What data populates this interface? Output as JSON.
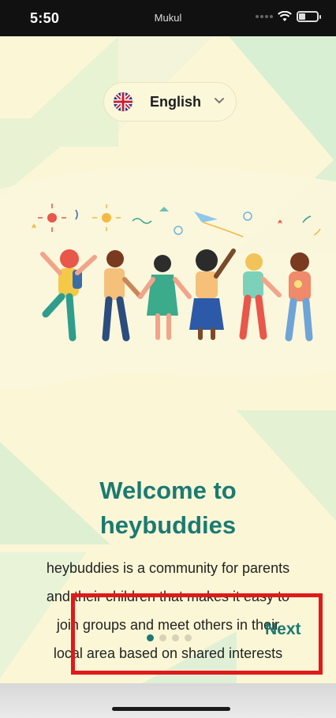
{
  "status_bar": {
    "time": "5:50",
    "carrier": "Mukul",
    "wifi_icon": "wifi-icon",
    "battery_icon": "battery-icon"
  },
  "language_selector": {
    "flag_icon": "uk-flag-icon",
    "label": "English",
    "chevron_icon": "chevron-down-icon"
  },
  "illustration": {
    "name": "children-holding-hands-illustration"
  },
  "welcome": {
    "title_line1": "Welcome to",
    "title_line2": "heybuddies",
    "body_line1": "heybuddies is a community for parents",
    "body_line2": "and their children that makes it easy to",
    "body_line3": "join groups and meet others in their",
    "body_line4": "local area based on shared interests"
  },
  "pager": {
    "total_pages": 4,
    "active_page": 1
  },
  "next_label": "Next",
  "colors": {
    "background": "#fbf7d6",
    "accent": "#1b7a73",
    "highlight": "#e0191a"
  }
}
